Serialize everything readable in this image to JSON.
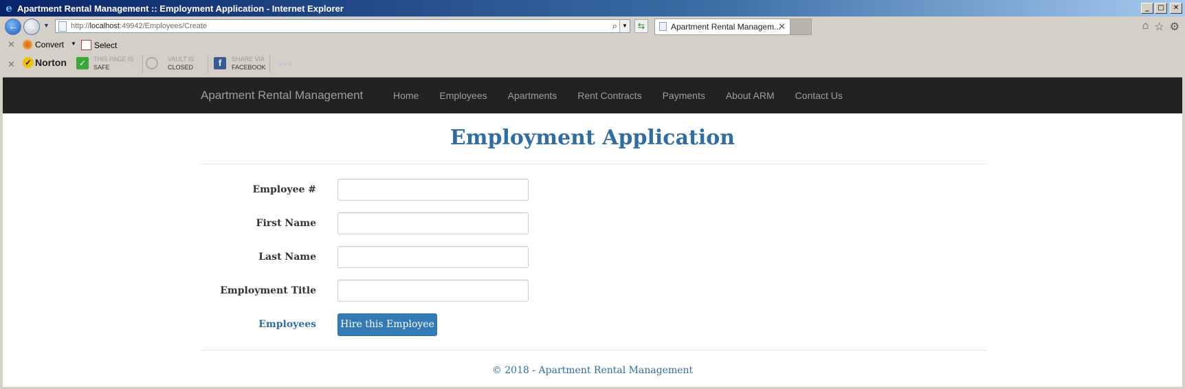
{
  "window": {
    "title": "Apartment Rental Management :: Employment Application - Internet Explorer",
    "minimize": "_",
    "maximize": "□",
    "close": "✕"
  },
  "address_bar": {
    "url_prefix": "http://",
    "url_host": "localhost",
    "url_rest": ":49942/Employees/Create",
    "tab_title": "Apartment Rental Managem...",
    "tab_close": "✕"
  },
  "command_bar": {
    "convert_label": "Convert",
    "select_label": "Select"
  },
  "norton_bar": {
    "brand": "Norton",
    "safe_line1": "THIS PAGE IS",
    "safe_line2": "SAFE",
    "vault_line1": "VAULT IS",
    "vault_line2": "CLOSED",
    "share_line1": "SHARE VIA",
    "share_line2": "FACEBOOK"
  },
  "site_nav": {
    "brand": "Apartment Rental Management",
    "links": [
      "Home",
      "Employees",
      "Apartments",
      "Rent Contracts",
      "Payments",
      "About ARM",
      "Contact Us"
    ]
  },
  "page": {
    "title": "Employment Application",
    "fields": [
      {
        "label": "Employee #",
        "value": ""
      },
      {
        "label": "First Name",
        "value": ""
      },
      {
        "label": "Last Name",
        "value": ""
      },
      {
        "label": "Employment Title",
        "value": ""
      }
    ],
    "back_link": "Employees",
    "submit_label": "Hire this Employee",
    "footer": "© 2018 - Apartment Rental Management"
  },
  "colors": {
    "accent": "#2f6da3",
    "button": "#337ab7",
    "navbar": "#222222"
  }
}
